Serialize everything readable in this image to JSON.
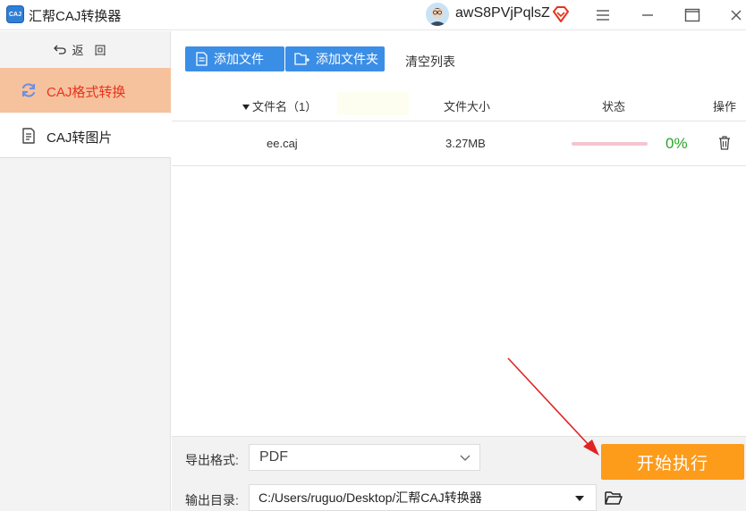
{
  "window": {
    "logo_text": "CAJ",
    "title": "汇帮CAJ转换器",
    "username": "awS8PVjPqlsZ"
  },
  "sidebar": {
    "back_label": "返回",
    "items": [
      {
        "label": "CAJ格式转换",
        "icon": "refresh-icon",
        "active": true
      },
      {
        "label": "CAJ转图片",
        "icon": "document-icon",
        "active": false
      }
    ]
  },
  "toolbar": {
    "add_file_label": "添加文件",
    "add_folder_label": "添加文件夹",
    "clear_label": "清空列表"
  },
  "table": {
    "columns": {
      "name": "文件名（1）",
      "size": "文件大小",
      "status": "状态",
      "action": "操作"
    },
    "rows": [
      {
        "name": "ee.caj",
        "size": "3.27MB",
        "progress": 0,
        "progress_text": "0%"
      }
    ]
  },
  "output": {
    "format_label": "导出格式:",
    "format_value": "PDF",
    "dir_label": "输出目录:",
    "dir_value": "C:/Users/ruguo/Desktop/汇帮CAJ转换器",
    "start_label": "开始执行"
  },
  "colors": {
    "accent_blue": "#3a8ee6",
    "active_nav_bg": "#f6c29e",
    "active_nav_text": "#e8331c",
    "start_button": "#fd9b1b",
    "progress_pink": "#f4c5cf",
    "percent_green": "#2aa52a",
    "annotation_arrow": "#e02424"
  }
}
